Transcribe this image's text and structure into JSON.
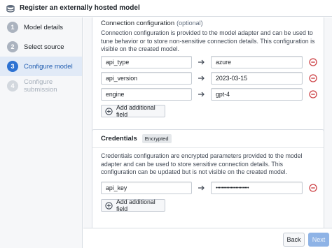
{
  "window": {
    "title": "Register an externally hosted model",
    "icon": "model-stack-icon"
  },
  "sidebar": {
    "steps": [
      {
        "num": "1",
        "label": "Model details",
        "state": "done"
      },
      {
        "num": "2",
        "label": "Select source",
        "state": "done"
      },
      {
        "num": "3",
        "label": "Configure model",
        "state": "active"
      },
      {
        "num": "4",
        "label": "Configure submission",
        "state": "disabled"
      }
    ]
  },
  "connection": {
    "title": "Connection configuration",
    "optional": "(optional)",
    "description": "Connection configuration is provided to the model adapter and can be used to tune behavior or to store non-sensitive connection details. This configuration is visible on the created model.",
    "rows": [
      {
        "key": "api_type",
        "value": "azure"
      },
      {
        "key": "api_version",
        "value": "2023-03-15"
      },
      {
        "key": "engine",
        "value": "gpt-4"
      }
    ],
    "add_label": "Add additional field"
  },
  "credentials": {
    "title": "Credentials",
    "badge": "Encrypted",
    "description": "Credentials configuration are encrypted parameters provided to the model adapter and can be used to store sensitive connection details. This configuration can be updated but is not visible on the created model.",
    "rows": [
      {
        "key": "api_key",
        "value": "••••••••••••••••••••••"
      }
    ],
    "add_label": "Add additional field"
  },
  "footer": {
    "back_label": "Back",
    "next_label": "Next"
  },
  "colors": {
    "accent": "#2d72d2",
    "remove": "#cd4246",
    "next_disabled": "#8eb3e6"
  }
}
